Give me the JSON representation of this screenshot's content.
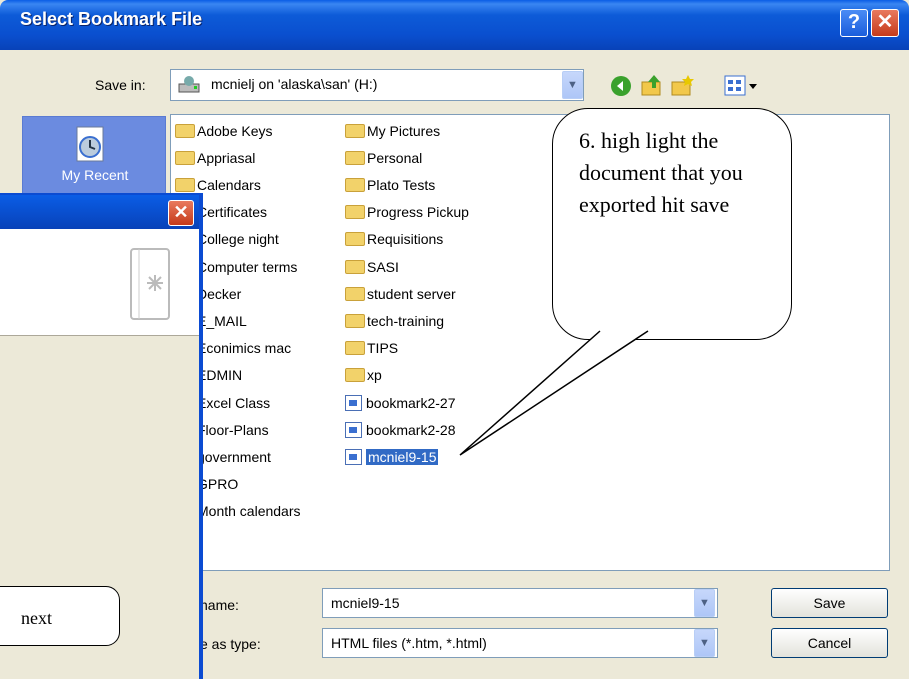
{
  "dialog": {
    "title": "Select Bookmark File",
    "help_glyph": "?",
    "close_glyph": "✕",
    "save_in_label": "Save in:",
    "save_in_value": "mcnielj on 'alaska\\san' (H:)",
    "toolbar_icons": [
      "back-icon",
      "up-folder-icon",
      "new-folder-icon",
      "views-menu-icon"
    ],
    "places": [
      {
        "label": "My Recent",
        "icon": "recent-documents-icon"
      }
    ],
    "folders_col1": [
      "Adobe Keys",
      "Appriasal",
      "Calendars",
      "Certificates",
      "College night",
      "Computer terms",
      "Decker",
      "E_MAIL",
      "Econimics mac",
      "EDMIN",
      "Excel Class",
      "Floor-Plans",
      "government",
      "GPRO",
      "Month calendars"
    ],
    "folders_col2": [
      "My Pictures",
      "Personal",
      "Plato Tests",
      "Progress Pickup",
      "Requisitions",
      "SASI",
      "student server",
      "tech-training",
      "TIPS",
      "xp"
    ],
    "files_col2": [
      "bookmark2-27",
      "bookmark2-28",
      "mcniel9-15"
    ],
    "selected_file": "mcniel9-15",
    "filename_label": "name:",
    "filename_value": "mcniel9-15",
    "filetype_label": "e as type:",
    "filetype_value": "HTML files (*.htm, *.html)",
    "save_button": "Save",
    "cancel_button": "Cancel"
  },
  "background_window": {
    "close_glyph": "✕",
    "icon": "import-wizard-icon"
  },
  "callouts": {
    "step6": "6. high light the document that you exported hit save",
    "next": "next"
  },
  "colors": {
    "title_blue": "#0a4fcf",
    "selection": "#316ac5",
    "dialog_bg": "#ece9d8"
  }
}
